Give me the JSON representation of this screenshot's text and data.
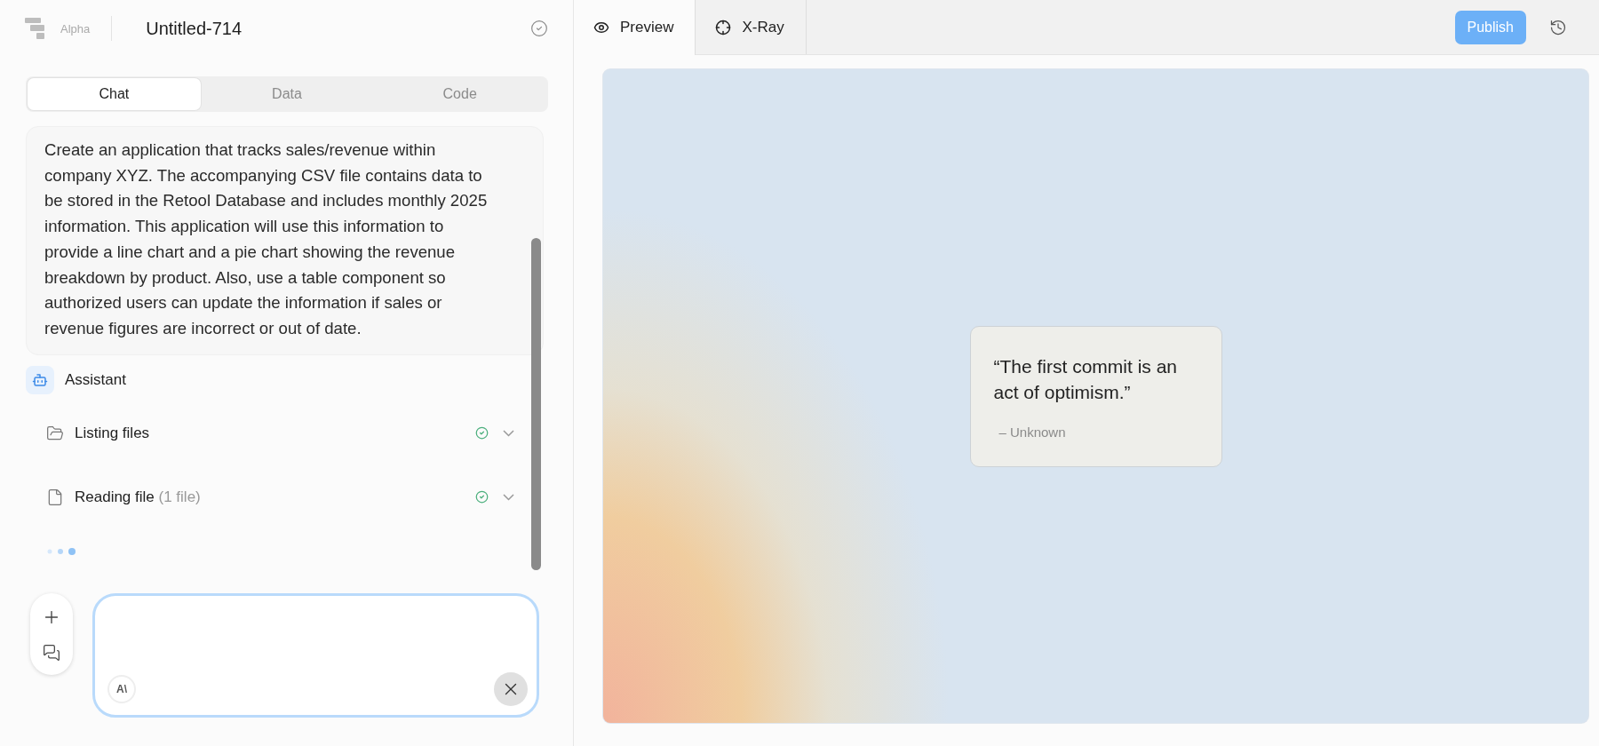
{
  "header": {
    "badge": "Alpha",
    "title": "Untitled-714",
    "saved": true
  },
  "panel_tabs": [
    {
      "label": "Chat",
      "selected": true
    },
    {
      "label": "Data",
      "selected": false
    },
    {
      "label": "Code",
      "selected": false
    }
  ],
  "message": "Create an application that tracks sales/revenue within company XYZ. The accompanying CSV file contains data to be stored in the Retool Database and includes monthly 2025 information. This application will use this information to provide a line chart and a pie chart showing the revenue breakdown by product. Also, use a table component so authorized users can update the information if sales or revenue figures are incorrect or out of date.",
  "assistant": {
    "name": "Assistant",
    "steps": [
      {
        "kind": "folder",
        "label": "Listing files",
        "done": true,
        "expanded": false
      },
      {
        "kind": "file",
        "label": "Reading file",
        "detail": "(1 file)",
        "done": true,
        "expanded": false
      }
    ],
    "loading": true
  },
  "composer": {
    "model_badge": "A\\"
  },
  "preview_tabs": [
    {
      "label": "Preview",
      "kind": "eye",
      "selected": true
    },
    {
      "label": "X-Ray",
      "kind": "crosshair",
      "selected": false
    }
  ],
  "publish": {
    "label": "Publish"
  },
  "quote": {
    "text": "“The first commit is an act of optimism.”",
    "author": "– Unknown"
  }
}
